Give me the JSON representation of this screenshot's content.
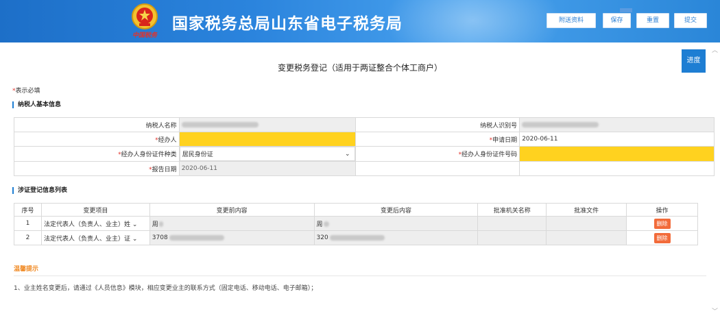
{
  "header": {
    "title": "国家税务总局山东省电子税务局",
    "emblem_caption": "中国税务",
    "buttons": [
      "附送资料",
      "保存",
      "重置",
      "提交"
    ]
  },
  "page": {
    "title": "变更税务登记（适用于两证整合个体工商户）",
    "progress_button": "进度",
    "required_note": "表示必填"
  },
  "basic_info": {
    "section_title": "纳税人基本信息",
    "taxpayer_name_label": "纳税人名称",
    "taxpayer_id_label": "纳税人识别号",
    "agent_label": "经办人",
    "apply_date_label": "申请日期",
    "apply_date": "2020-06-11",
    "agent_id_type_label": "经办人身份证件种类",
    "agent_id_type_value": "居民身份证",
    "agent_id_number_label": "经办人身份证件号码",
    "report_date_label": "报告日期",
    "report_date": "2020-06-11"
  },
  "changes": {
    "section_title": "涉证登记信息列表",
    "columns": [
      "序号",
      "变更项目",
      "变更前内容",
      "变更后内容",
      "批准机关名称",
      "批准文件",
      "操作"
    ],
    "rows": [
      {
        "no": "1",
        "item": "法定代表人（负责人、业主）姓",
        "before": "周",
        "after": "周",
        "action": "删除"
      },
      {
        "no": "2",
        "item": "法定代表人（负责人、业主）证",
        "before": "3708",
        "after": "320",
        "action": "删除"
      }
    ]
  },
  "tips": {
    "title": "温馨提示",
    "text": "1、业主姓名变更后，请通过《人员信息》模块，相应变更业主的联系方式（固定电话、移动电话、电子邮箱）；"
  },
  "colors": {
    "header_blue": "#2b84dd",
    "required_yellow": "#ffd21f",
    "delete_orange": "#f26b3a"
  }
}
